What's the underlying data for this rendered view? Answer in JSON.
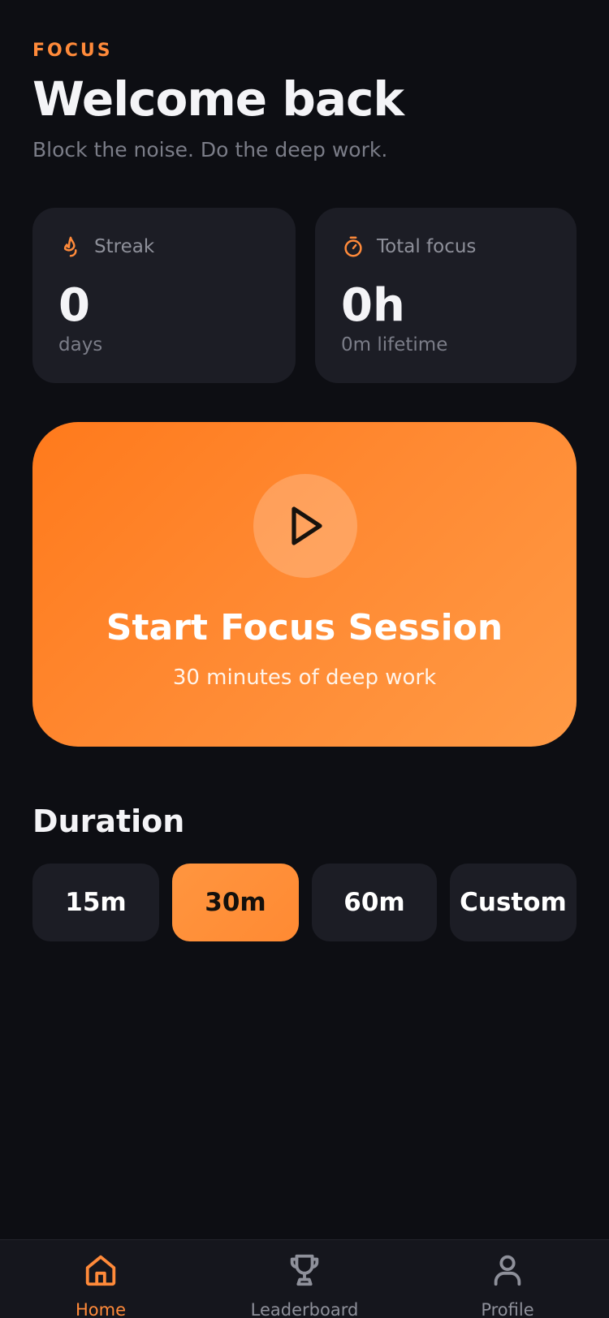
{
  "header": {
    "eyebrow": "FOCUS",
    "title": "Welcome back",
    "subtitle": "Block the noise. Do the deep work."
  },
  "stats": {
    "streak": {
      "label": "Streak",
      "value": "0",
      "sub": "days",
      "icon": "flame-icon"
    },
    "total": {
      "label": "Total focus",
      "value": "0h",
      "sub": "0m lifetime",
      "icon": "stopwatch-icon"
    }
  },
  "cta": {
    "title": "Start Focus Session",
    "subtitle": "30 minutes of deep work",
    "icon": "play-icon"
  },
  "duration": {
    "title": "Duration",
    "options": [
      "15m",
      "30m",
      "60m",
      "Custom"
    ],
    "selected": "30m"
  },
  "tabs": [
    {
      "label": "Home",
      "icon": "home-icon",
      "active": true
    },
    {
      "label": "Leaderboard",
      "icon": "trophy-icon",
      "active": false
    },
    {
      "label": "Profile",
      "icon": "profile-icon",
      "active": false
    }
  ],
  "colors": {
    "accent": "#ff8a3a",
    "background": "#0d0e13",
    "card": "#1c1d25",
    "muted_text": "#7b7d88"
  }
}
